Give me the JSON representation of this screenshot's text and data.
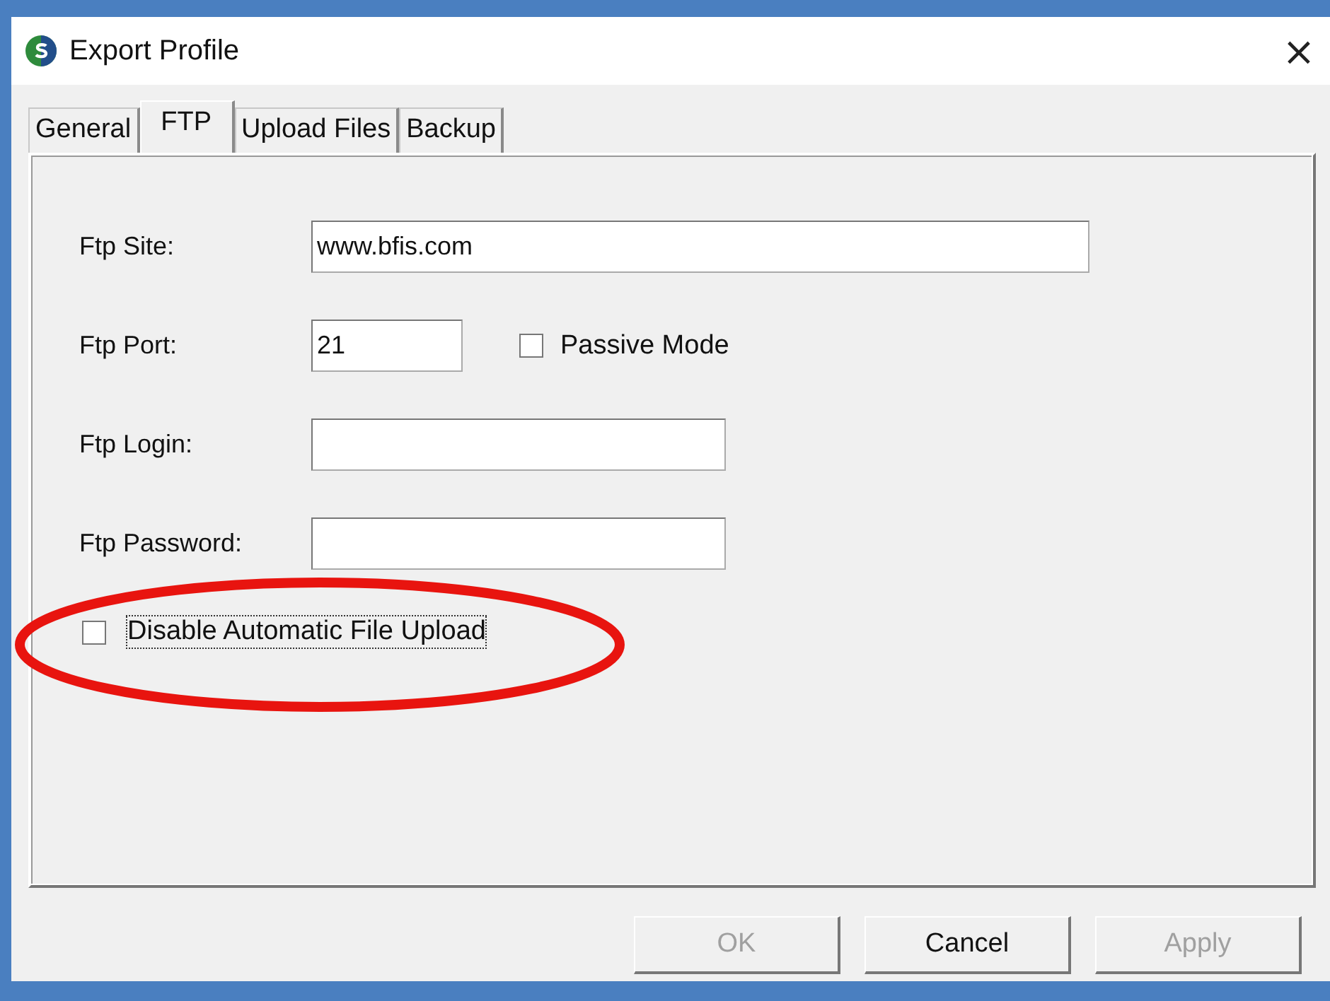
{
  "window": {
    "title": "Export Profile",
    "close": "×"
  },
  "tabs": [
    {
      "label": "General",
      "selected": false
    },
    {
      "label": "FTP",
      "selected": true
    },
    {
      "label": "Upload Files",
      "selected": false
    },
    {
      "label": "Backup",
      "selected": false
    }
  ],
  "fields": [
    {
      "label": "Ftp Site:",
      "value": "www.bfis.com"
    },
    {
      "label": "Ftp Port:",
      "value": "21",
      "checkbox": {
        "label": "Passive Mode",
        "checked": false
      }
    },
    {
      "label": "Ftp Login:"
    },
    {
      "label": "Ftp Password:"
    }
  ],
  "disable_upload": {
    "label": "Disable Automatic File Upload",
    "checked": false,
    "focused": true
  },
  "buttons": [
    {
      "label": "OK",
      "disabled": true
    },
    {
      "label": "Cancel",
      "disabled": false
    },
    {
      "label": "Apply",
      "disabled": true
    }
  ]
}
